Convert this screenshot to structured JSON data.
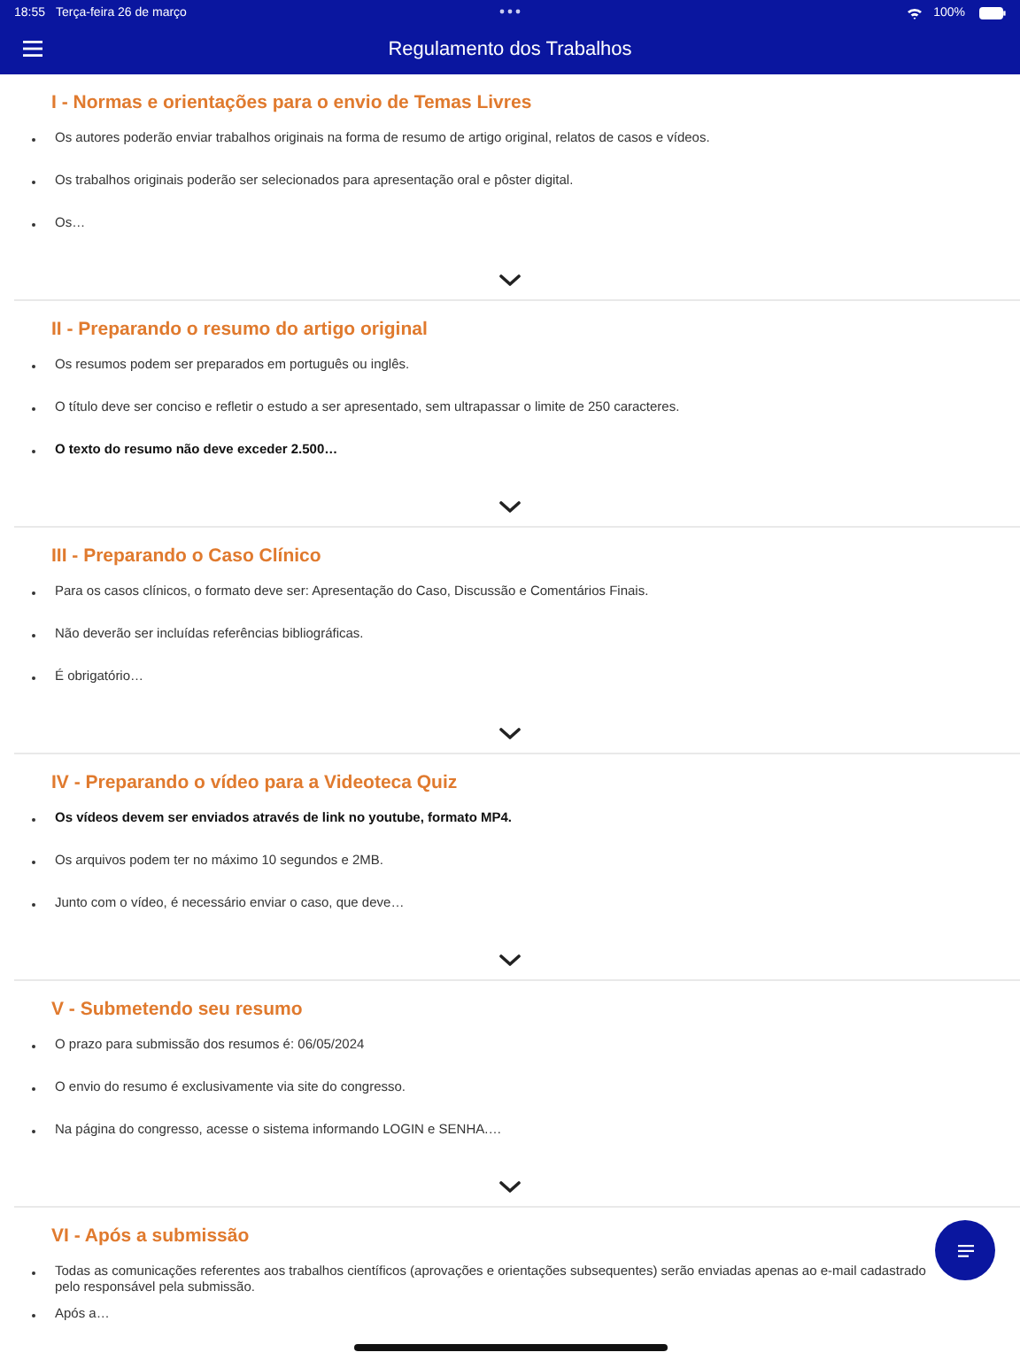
{
  "status_bar": {
    "time": "18:55",
    "date": "Terça-feira 26 de março",
    "battery": "100%"
  },
  "nav": {
    "title": "Regulamento dos Trabalhos"
  },
  "sections": [
    {
      "title": "I - Normas e orientações para o envio de Temas Livres",
      "items": [
        {
          "text": "Os autores poderão enviar trabalhos originais na forma de resumo de artigo original, relatos de casos e vídeos.",
          "bold": false
        },
        {
          "text": "Os trabalhos originais poderão ser selecionados para apresentação oral e pôster digital.",
          "bold": false
        },
        {
          "text": "Os…",
          "bold": false
        }
      ]
    },
    {
      "title": "II - Preparando o resumo do artigo original",
      "items": [
        {
          "text": "Os resumos podem ser preparados em português ou inglês.",
          "bold": false
        },
        {
          "text": "O título deve ser conciso e refletir o estudo a ser apresentado, sem ultrapassar o limite de 250 caracteres.",
          "bold": false
        },
        {
          "text": "O texto do resumo não deve exceder 2.500…",
          "bold": true
        }
      ]
    },
    {
      "title": "III - Preparando o Caso Clínico",
      "items": [
        {
          "text": "Para os casos clínicos, o formato deve ser: Apresentação do Caso, Discussão e Comentários Finais.",
          "bold": false
        },
        {
          "text": "Não deverão ser incluídas referências bibliográficas.",
          "bold": false
        },
        {
          "text": "É obrigatório…",
          "bold": false
        }
      ]
    },
    {
      "title": "IV - Preparando o vídeo para a Videoteca Quiz",
      "items": [
        {
          "text": "Os vídeos devem ser enviados através de link no youtube, formato MP4.",
          "bold": true
        },
        {
          "text": "Os arquivos podem ter no máximo 10 segundos e 2MB.",
          "bold": false
        },
        {
          "text": "Junto com o vídeo, é necessário enviar o caso, que deve…",
          "bold": false
        }
      ]
    },
    {
      "title": "V - Submetendo seu resumo",
      "items": [
        {
          "text": "O prazo para submissão dos resumos é: 06/05/2024",
          "bold": false
        },
        {
          "text": "O envio do resumo é exclusivamente via site do congresso.",
          "bold": false
        },
        {
          "text": "Na página do congresso, acesse o sistema informando LOGIN e SENHA.…",
          "bold": false
        }
      ]
    },
    {
      "title": "VI - Após a submissão",
      "items": [
        {
          "text": "Todas as comunicações referentes aos trabalhos científicos (aprovações e orientações subsequentes) serão enviadas apenas ao e-mail cadastrado pelo responsável pela submissão.",
          "bold": false
        },
        {
          "text": "Após a…",
          "bold": false
        }
      ]
    }
  ]
}
